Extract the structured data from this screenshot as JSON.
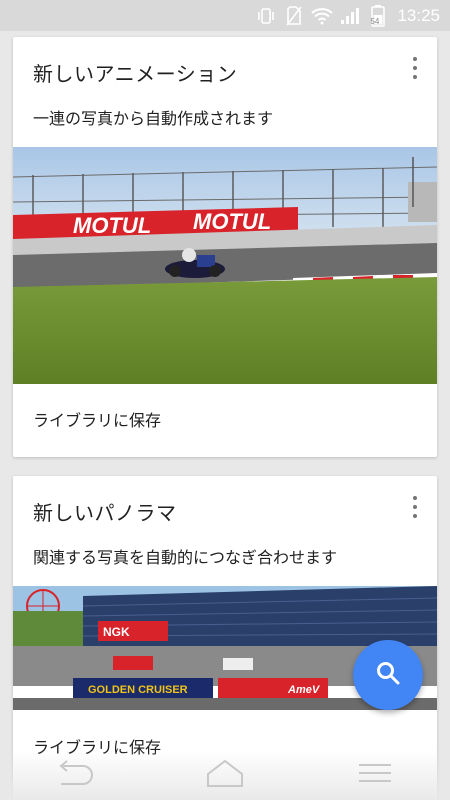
{
  "status_bar": {
    "time": "13:25",
    "battery_level": "54",
    "icons": [
      "vibrate-icon",
      "no-sim-icon",
      "wifi-icon",
      "signal-icon",
      "battery-icon"
    ]
  },
  "cards": [
    {
      "title": "新しいアニメーション",
      "subtitle": "一連の写真から自動作成されます",
      "action": "ライブラリに保存",
      "image_desc": "motorcycle-race-photo"
    },
    {
      "title": "新しいパノラマ",
      "subtitle": "関連する写真を自動的につなぎ合わせます",
      "action": "ライブラリに保存",
      "image_desc": "circuit-panorama-photo"
    }
  ],
  "fab": {
    "icon": "search-icon"
  },
  "colors": {
    "accent": "#4285f4",
    "background": "#e8e8e8",
    "card": "#ffffff"
  }
}
